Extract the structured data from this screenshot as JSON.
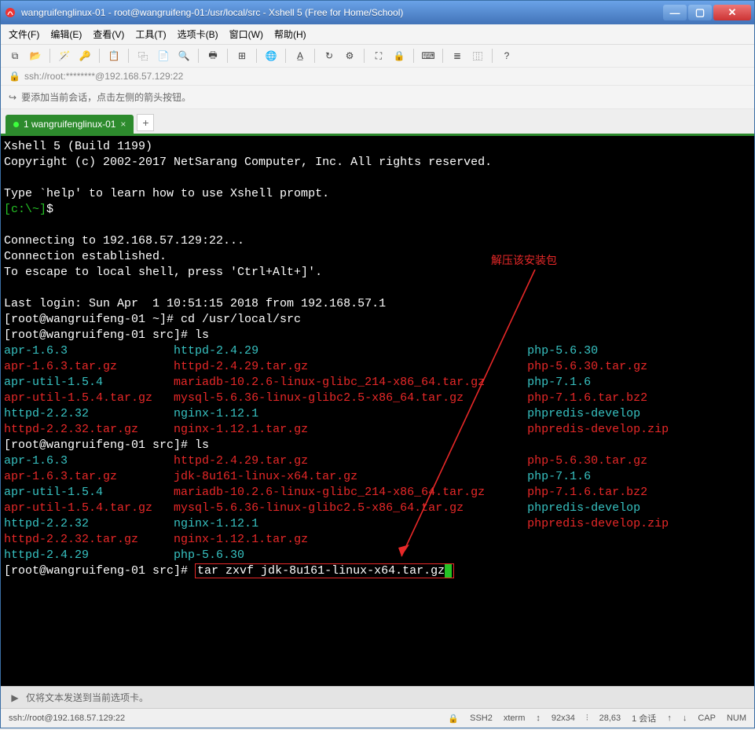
{
  "window": {
    "title": "wangruifenglinux-01 - root@wangruifeng-01:/usr/local/src - Xshell 5 (Free for Home/School)"
  },
  "menu": [
    "文件(F)",
    "编辑(E)",
    "查看(V)",
    "工具(T)",
    "选项卡(B)",
    "窗口(W)",
    "帮助(H)"
  ],
  "address": "ssh://root:********@192.168.57.129:22",
  "infobar": "要添加当前会话，点击左侧的箭头按钮。",
  "tab": {
    "label": "1 wangruifenglinux-01"
  },
  "term": {
    "build": "Xshell 5 (Build 1199)",
    "copyright": "Copyright (c) 2002-2017 NetSarang Computer, Inc. All rights reserved.",
    "help": "Type `help' to learn how to use Xshell prompt.",
    "localprompt_pre": "[c:\\~]",
    "localprompt_sym": "$",
    "connecting": "Connecting to 192.168.57.129:22...",
    "established": "Connection established.",
    "escape": "To escape to local shell, press 'Ctrl+Alt+]'.",
    "lastlogin": "Last login: Sun Apr  1 10:51:15 2018 from 192.168.57.1",
    "prompt1": "[root@wangruifeng-01 ~]# ",
    "cmd_cd": "cd /usr/local/src",
    "prompt2": "[root@wangruifeng-01 src]# ",
    "cmd_ls": "ls",
    "ls1": {
      "c1": [
        "apr-1.6.3",
        "apr-1.6.3.tar.gz",
        "apr-util-1.5.4",
        "apr-util-1.5.4.tar.gz",
        "httpd-2.2.32",
        "httpd-2.2.32.tar.gz"
      ],
      "c2": [
        "httpd-2.4.29",
        "httpd-2.4.29.tar.gz",
        "mariadb-10.2.6-linux-glibc_214-x86_64.tar.gz",
        "mysql-5.6.36-linux-glibc2.5-x86_64.tar.gz",
        "nginx-1.12.1",
        "nginx-1.12.1.tar.gz"
      ],
      "c3": [
        "php-5.6.30",
        "php-5.6.30.tar.gz",
        "php-7.1.6",
        "php-7.1.6.tar.bz2",
        "phpredis-develop",
        "phpredis-develop.zip"
      ],
      "cls1": [
        "c",
        "r",
        "c",
        "r",
        "c",
        "r"
      ],
      "cls2": [
        "c",
        "r",
        "r",
        "r",
        "c",
        "r"
      ],
      "cls3": [
        "c",
        "r",
        "c",
        "r",
        "c",
        "r"
      ]
    },
    "ls2": {
      "c1": [
        "apr-1.6.3",
        "apr-1.6.3.tar.gz",
        "apr-util-1.5.4",
        "apr-util-1.5.4.tar.gz",
        "httpd-2.2.32",
        "httpd-2.2.32.tar.gz",
        "httpd-2.4.29"
      ],
      "c2": [
        "httpd-2.4.29.tar.gz",
        "jdk-8u161-linux-x64.tar.gz",
        "mariadb-10.2.6-linux-glibc_214-x86_64.tar.gz",
        "mysql-5.6.36-linux-glibc2.5-x86_64.tar.gz",
        "nginx-1.12.1",
        "nginx-1.12.1.tar.gz",
        "php-5.6.30"
      ],
      "c3": [
        "php-5.6.30.tar.gz",
        "php-7.1.6",
        "php-7.1.6.tar.bz2",
        "phpredis-develop",
        "phpredis-develop.zip",
        "",
        ""
      ],
      "cls1": [
        "c",
        "r",
        "c",
        "r",
        "c",
        "r",
        "c"
      ],
      "cls2": [
        "r",
        "r",
        "r",
        "r",
        "c",
        "r",
        "c"
      ],
      "cls3": [
        "r",
        "c",
        "r",
        "c",
        "r",
        "",
        ""
      ]
    },
    "cmd_tar": "tar zxvf jdk-8u161-linux-x64.tar.gz"
  },
  "annotation": "解压该安装包",
  "sendbar": "仅将文本发送到当前选项卡。",
  "status": {
    "conn": "ssh://root@192.168.57.129:22",
    "proto": "SSH2",
    "termtype": "xterm",
    "size": "92x34",
    "pos": "28,63",
    "sessions": "1 会话",
    "cap": "CAP",
    "num": "NUM"
  }
}
